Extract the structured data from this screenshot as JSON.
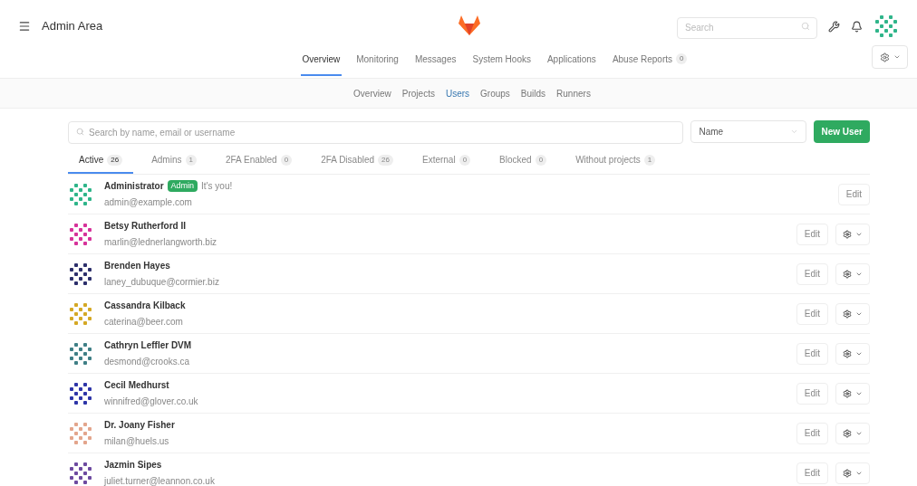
{
  "header": {
    "title": "Admin Area",
    "search": {
      "placeholder": "Search"
    }
  },
  "main_nav": [
    {
      "label": "Overview",
      "selected": true
    },
    {
      "label": "Monitoring",
      "selected": false
    },
    {
      "label": "Messages",
      "selected": false
    },
    {
      "label": "System Hooks",
      "selected": false
    },
    {
      "label": "Applications",
      "selected": false
    },
    {
      "label": "Abuse Reports",
      "count": "0",
      "selected": false
    }
  ],
  "sub_nav": [
    {
      "label": "Overview",
      "selected": false
    },
    {
      "label": "Projects",
      "selected": false
    },
    {
      "label": "Users",
      "selected": true
    },
    {
      "label": "Groups",
      "selected": false
    },
    {
      "label": "Builds",
      "selected": false
    },
    {
      "label": "Runners",
      "selected": false
    }
  ],
  "user_search": {
    "placeholder": "Search by name, email or username"
  },
  "sort": {
    "value": "Name"
  },
  "new_user_button": "New User",
  "filter_tabs": [
    {
      "label": "Active",
      "count": "26",
      "selected": true
    },
    {
      "label": "Admins",
      "count": "1",
      "selected": false
    },
    {
      "label": "2FA Enabled",
      "count": "0",
      "selected": false
    },
    {
      "label": "2FA Disabled",
      "count": "26",
      "selected": false
    },
    {
      "label": "External",
      "count": "0",
      "selected": false
    },
    {
      "label": "Blocked",
      "count": "0",
      "selected": false
    },
    {
      "label": "Without projects",
      "count": "1",
      "selected": false
    }
  ],
  "users": [
    {
      "name": "Administrator",
      "badge": "Admin",
      "note": "It's you!",
      "email": "admin@example.com",
      "color": "#2fb58a",
      "edit": "Edit",
      "actions_menu": false
    },
    {
      "name": "Betsy Rutherford II",
      "email": "marlin@lednerlangworth.biz",
      "color": "#d6339a",
      "edit": "Edit",
      "actions_menu": true
    },
    {
      "name": "Brenden Hayes",
      "email": "laney_dubuque@cormier.biz",
      "color": "#2c2f6b",
      "edit": "Edit",
      "actions_menu": true
    },
    {
      "name": "Cassandra Kilback",
      "email": "caterina@beer.com",
      "color": "#d4a824",
      "edit": "Edit",
      "actions_menu": true
    },
    {
      "name": "Cathryn Leffler DVM",
      "email": "desmond@crooks.ca",
      "color": "#3f7f86",
      "edit": "Edit",
      "actions_menu": true
    },
    {
      "name": "Cecil Medhurst",
      "email": "winnifred@glover.co.uk",
      "color": "#2e35a8",
      "edit": "Edit",
      "actions_menu": true
    },
    {
      "name": "Dr. Joany Fisher",
      "email": "milan@huels.us",
      "color": "#e3a58c",
      "edit": "Edit",
      "actions_menu": true
    },
    {
      "name": "Jazmin Sipes",
      "email": "juliet.turner@leannon.co.uk",
      "color": "#6d4aa0",
      "edit": "Edit",
      "actions_menu": true
    }
  ]
}
